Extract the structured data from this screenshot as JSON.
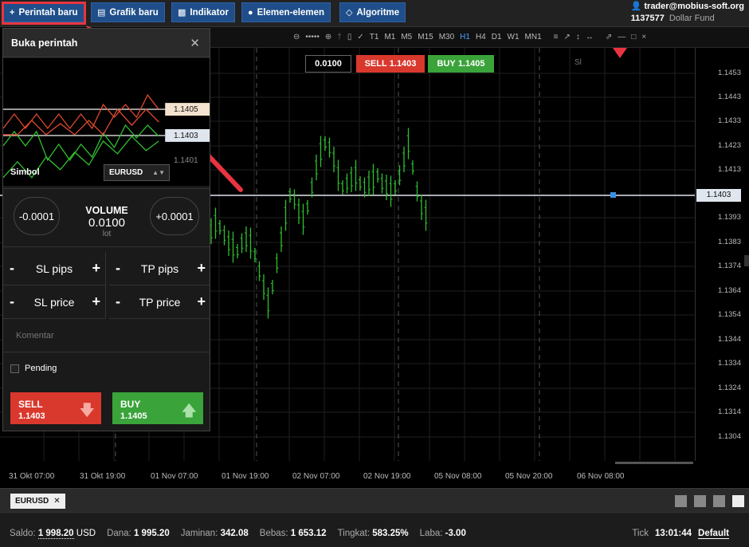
{
  "toolbar": {
    "new_order": "Perintah baru",
    "new_chart": "Grafik baru",
    "indicator": "Indikator",
    "elements": "Elemen-elemen",
    "algorithm": "Algoritme"
  },
  "account": {
    "email": "trader@mobius-soft.org",
    "number": "1137577",
    "fund": "Dollar Fund"
  },
  "chart_toolbar": {
    "timeframes": [
      "T1",
      "M1",
      "M5",
      "M15",
      "M30",
      "H1",
      "H4",
      "D1",
      "W1",
      "MN1"
    ],
    "active_timeframe": "H1"
  },
  "chart_overlay": {
    "volume": "0.0100",
    "sell_label": "SELL",
    "sell_price": "1.1403",
    "buy_label": "BUY",
    "buy_price": "1.1405",
    "sl_marker": "Sl"
  },
  "price_axis": {
    "labels": [
      "1.1453",
      "1.1443",
      "1.1433",
      "1.1423",
      "1.1413",
      "1.1393",
      "1.1383",
      "1.1374",
      "1.1364",
      "1.1354",
      "1.1344",
      "1.1334",
      "1.1324",
      "1.1314",
      "1.1304"
    ],
    "current": "1.1403"
  },
  "time_axis": {
    "labels": [
      "31 Okt 07:00",
      "31 Okt 19:00",
      "01 Nov 07:00",
      "01 Nov 19:00",
      "02 Nov 07:00",
      "02 Nov 19:00",
      "05 Nov 08:00",
      "05 Nov 20:00",
      "06 Nov 08:00"
    ]
  },
  "order_panel": {
    "title": "Buka perintah",
    "mini_ask": "1.1405",
    "mini_bid": "1.1403",
    "mini_low": "1.1401",
    "symbol_label": "Simbol",
    "symbol_value": "EURUSD",
    "vol_minus": "-0.0001",
    "vol_plus": "+0.0001",
    "volume_label": "VOLUME",
    "volume_value": "0.0100",
    "volume_unit": "lot",
    "minus_sign": "-",
    "plus_sign": "+",
    "sl_pips": "SL pips",
    "tp_pips": "TP pips",
    "sl_price": "SL price",
    "tp_price": "TP price",
    "comment_placeholder": "Komentar",
    "pending_label": "Pending",
    "sell_label": "SELL",
    "sell_price": "1.1403",
    "buy_label": "BUY",
    "buy_price": "1.1405"
  },
  "tabs": {
    "symbol": "EURUSD"
  },
  "status": {
    "saldo_label": "Saldo:",
    "saldo_value": "1 998.20",
    "saldo_currency": "USD",
    "dana_label": "Dana:",
    "dana_value": "1 995.20",
    "jaminan_label": "Jaminan:",
    "jaminan_value": "342.08",
    "bebas_label": "Bebas:",
    "bebas_value": "1 653.12",
    "tingkat_label": "Tingkat:",
    "tingkat_value": "583.25%",
    "laba_label": "Laba:",
    "laba_value": "-3.00",
    "tick_label": "Tick",
    "tick_time": "13:01:44",
    "default_label": "Default"
  },
  "colors": {
    "sell": "#d9382d",
    "buy": "#3aa33a",
    "toolbar_button": "#1f4e8a",
    "highlight": "#e8343f",
    "candle": "#2fbf2f"
  }
}
